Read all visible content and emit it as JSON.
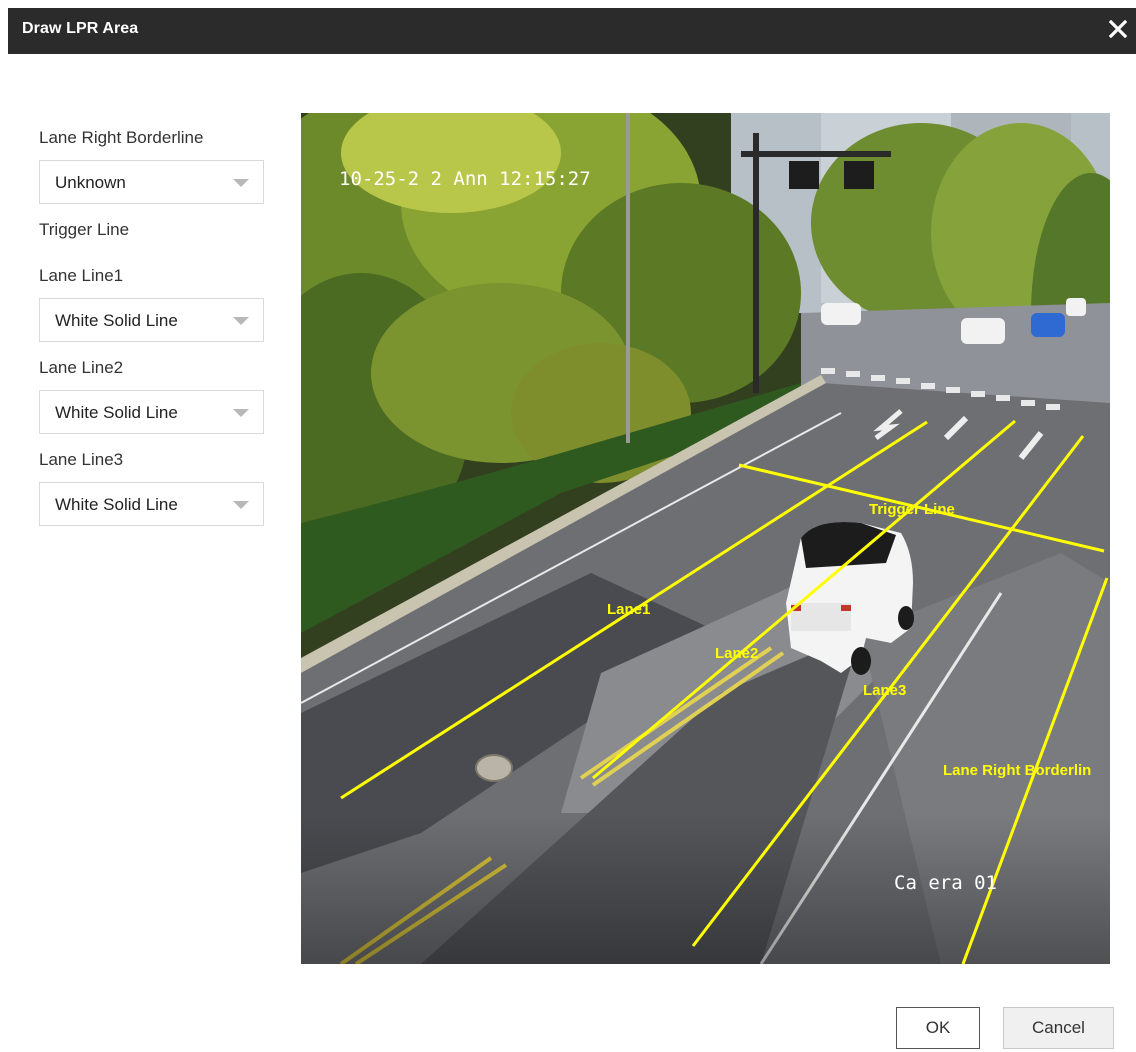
{
  "dialog": {
    "title": "Draw LPR Area",
    "close_icon": "close-icon"
  },
  "sidebar": {
    "lane_right_borderline_label": "Lane Right Borderline",
    "lane_right_borderline_value": "Unknown",
    "trigger_line_label": "Trigger Line",
    "lane_line1_label": "Lane Line1",
    "lane_line1_value": "White Solid Line",
    "lane_line2_label": "Lane Line2",
    "lane_line2_value": "White Solid Line",
    "lane_line3_label": "Lane Line3",
    "lane_line3_value": "White Solid Line",
    "dropdown_icon": "chevron-down-icon"
  },
  "video": {
    "osd_timestamp": "10-25-2 2 Ann 12:15:27",
    "osd_camera": "Ca era 01",
    "overlay_color": "#ffff00",
    "overlays": {
      "trigger_line": "Trigger Line",
      "lane1": "Lane1",
      "lane2": "Lane2",
      "lane3": "Lane3",
      "lane_right_borderline": "Lane Right Borderlin"
    }
  },
  "footer": {
    "ok_label": "OK",
    "cancel_label": "Cancel"
  }
}
